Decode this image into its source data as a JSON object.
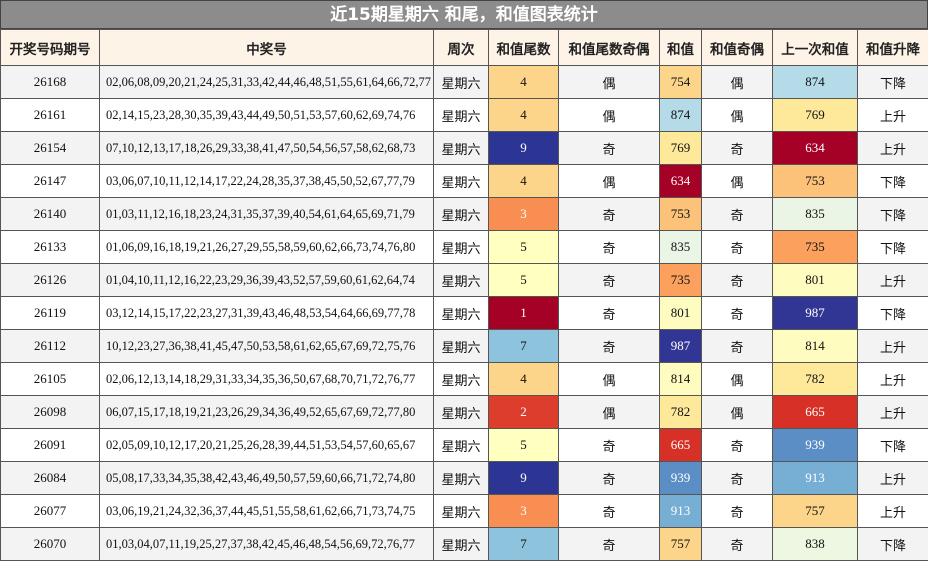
{
  "title": "近15期星期六 和尾，和值图表统计",
  "headers": [
    "开奖号码期号",
    "中奖号",
    "周次",
    "和值尾数",
    "和值尾数奇偶",
    "和值",
    "和值奇偶",
    "上一次和值",
    "和值升降"
  ],
  "rows": [
    {
      "period": "26168",
      "numbers": "02,06,08,09,20,21,24,25,31,33,42,44,46,48,51,55,61,64,66,72,77",
      "weekday": "星期六",
      "tail": "4",
      "tail_parity": "偶",
      "sum": "754",
      "sum_parity": "偶",
      "prev_sum": "874",
      "trend": "下降",
      "tail_color": "#fdd58a",
      "sum_color": "#fdd58a",
      "prev_color": "#b5dbe9"
    },
    {
      "period": "26161",
      "numbers": "02,14,15,23,28,30,35,39,43,44,49,50,51,53,57,60,62,69,74,76",
      "weekday": "星期六",
      "tail": "4",
      "tail_parity": "偶",
      "sum": "874",
      "sum_parity": "偶",
      "prev_sum": "769",
      "trend": "上升",
      "tail_color": "#fdd58a",
      "sum_color": "#b5dbe9",
      "prev_color": "#fee99a"
    },
    {
      "period": "26154",
      "numbers": "07,10,12,13,17,18,26,29,33,38,41,47,50,54,56,57,58,62,68,73",
      "weekday": "星期六",
      "tail": "9",
      "tail_parity": "奇",
      "sum": "769",
      "sum_parity": "奇",
      "prev_sum": "634",
      "trend": "上升",
      "tail_color": "#2c3594",
      "sum_color": "#fee99a",
      "prev_color": "#a50026"
    },
    {
      "period": "26147",
      "numbers": "03,06,07,10,11,12,14,17,22,24,28,35,37,38,45,50,52,67,77,79",
      "weekday": "星期六",
      "tail": "4",
      "tail_parity": "偶",
      "sum": "634",
      "sum_parity": "偶",
      "prev_sum": "753",
      "trend": "下降",
      "tail_color": "#fdd58a",
      "sum_color": "#a50026",
      "prev_color": "#fdc27a"
    },
    {
      "period": "26140",
      "numbers": "01,03,11,12,16,18,23,24,31,35,37,39,40,54,61,64,65,69,71,79",
      "weekday": "星期六",
      "tail": "3",
      "tail_parity": "奇",
      "sum": "753",
      "sum_parity": "奇",
      "prev_sum": "835",
      "trend": "下降",
      "tail_color": "#f98e52",
      "sum_color": "#fdc27a",
      "prev_color": "#eaf5e6"
    },
    {
      "period": "26133",
      "numbers": "01,06,09,16,18,19,21,26,27,29,55,58,59,60,62,66,73,74,76,80",
      "weekday": "星期六",
      "tail": "5",
      "tail_parity": "奇",
      "sum": "835",
      "sum_parity": "奇",
      "prev_sum": "735",
      "trend": "下降",
      "tail_color": "#ffffc0",
      "sum_color": "#eaf5e6",
      "prev_color": "#fba15d"
    },
    {
      "period": "26126",
      "numbers": "01,04,10,11,12,16,22,23,29,36,39,43,52,57,59,60,61,62,64,74",
      "weekday": "星期六",
      "tail": "5",
      "tail_parity": "奇",
      "sum": "735",
      "sum_parity": "奇",
      "prev_sum": "801",
      "trend": "上升",
      "tail_color": "#ffffc0",
      "sum_color": "#fba15d",
      "prev_color": "#fffcc0"
    },
    {
      "period": "26119",
      "numbers": "03,12,14,15,17,22,23,27,31,39,43,46,48,53,54,64,66,69,77,78",
      "weekday": "星期六",
      "tail": "1",
      "tail_parity": "奇",
      "sum": "801",
      "sum_parity": "奇",
      "prev_sum": "987",
      "trend": "下降",
      "tail_color": "#a50026",
      "sum_color": "#fffcc0",
      "prev_color": "#313695"
    },
    {
      "period": "26112",
      "numbers": "10,12,23,27,36,38,41,45,47,50,53,58,61,62,65,67,69,72,75,76",
      "weekday": "星期六",
      "tail": "7",
      "tail_parity": "奇",
      "sum": "987",
      "sum_parity": "奇",
      "prev_sum": "814",
      "trend": "上升",
      "tail_color": "#8ec3de",
      "sum_color": "#313695",
      "prev_color": "#fffcc0"
    },
    {
      "period": "26105",
      "numbers": "02,06,12,13,14,18,29,31,33,34,35,36,50,67,68,70,71,72,76,77",
      "weekday": "星期六",
      "tail": "4",
      "tail_parity": "偶",
      "sum": "814",
      "sum_parity": "偶",
      "prev_sum": "782",
      "trend": "上升",
      "tail_color": "#fdd58a",
      "sum_color": "#fffcc0",
      "prev_color": "#fee99a"
    },
    {
      "period": "26098",
      "numbers": "06,07,15,17,18,19,21,23,26,29,34,36,49,52,65,67,69,72,77,80",
      "weekday": "星期六",
      "tail": "2",
      "tail_parity": "偶",
      "sum": "782",
      "sum_parity": "偶",
      "prev_sum": "665",
      "trend": "上升",
      "tail_color": "#dd3d2d",
      "sum_color": "#fee99a",
      "prev_color": "#d73027"
    },
    {
      "period": "26091",
      "numbers": "02,05,09,10,12,17,20,21,25,26,28,39,44,51,53,54,57,60,65,67",
      "weekday": "星期六",
      "tail": "5",
      "tail_parity": "奇",
      "sum": "665",
      "sum_parity": "奇",
      "prev_sum": "939",
      "trend": "下降",
      "tail_color": "#ffffc0",
      "sum_color": "#d73027",
      "prev_color": "#5b8ec4"
    },
    {
      "period": "26084",
      "numbers": "05,08,17,33,34,35,38,42,43,46,49,50,57,59,60,66,71,72,74,80",
      "weekday": "星期六",
      "tail": "9",
      "tail_parity": "奇",
      "sum": "939",
      "sum_parity": "奇",
      "prev_sum": "913",
      "trend": "上升",
      "tail_color": "#2c3594",
      "sum_color": "#5b8ec4",
      "prev_color": "#77aed3"
    },
    {
      "period": "26077",
      "numbers": "03,06,19,21,24,32,36,37,44,45,51,55,58,61,62,66,71,73,74,75",
      "weekday": "星期六",
      "tail": "3",
      "tail_parity": "奇",
      "sum": "913",
      "sum_parity": "奇",
      "prev_sum": "757",
      "trend": "上升",
      "tail_color": "#f98e52",
      "sum_color": "#77aed3",
      "prev_color": "#fdd58a"
    },
    {
      "period": "26070",
      "numbers": "01,03,04,07,11,19,25,27,37,38,42,45,46,48,54,56,69,72,76,77",
      "weekday": "星期六",
      "tail": "7",
      "tail_parity": "奇",
      "sum": "757",
      "sum_parity": "奇",
      "prev_sum": "838",
      "trend": "下降",
      "tail_color": "#8ec3de",
      "sum_color": "#fdd58a",
      "prev_color": "#eef7e2"
    }
  ]
}
